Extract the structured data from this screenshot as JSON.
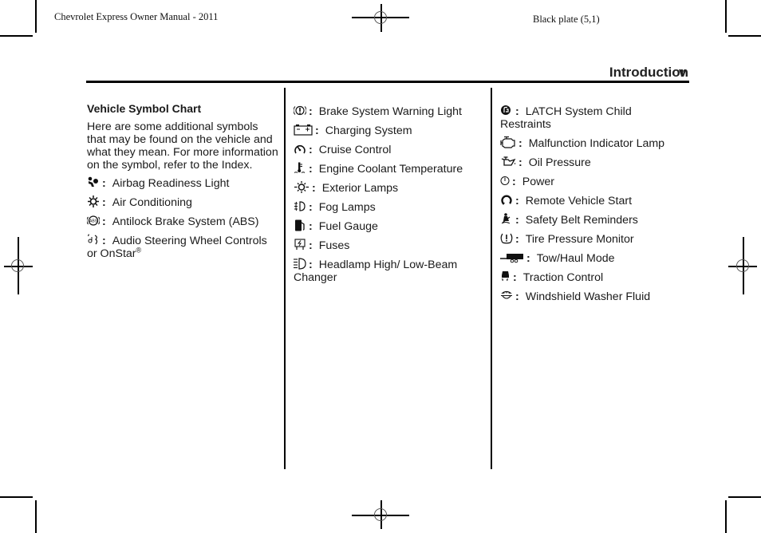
{
  "print_header": {
    "manual_title": "Chevrolet Express Owner Manual - 2011",
    "plate": "Black plate (5,1)"
  },
  "page_header": {
    "section": "Introduction",
    "page_number": "v"
  },
  "column1": {
    "heading": "Vehicle Symbol Chart",
    "intro": "Here are some additional symbols that may be found on the vehicle and what they mean. For more information on the symbol, refer to the Index.",
    "items": [
      {
        "icon": "airbag-icon",
        "label": "Airbag Readiness Light"
      },
      {
        "icon": "air-conditioning-icon",
        "label": "Air Conditioning"
      },
      {
        "icon": "abs-icon",
        "label": "Antilock Brake System (ABS)"
      },
      {
        "icon": "audio-steering-controls-icon",
        "label": "Audio Steering Wheel Controls or OnStar",
        "suffix": "®"
      }
    ]
  },
  "column2": {
    "items": [
      {
        "icon": "brake-warning-icon",
        "label": "Brake System Warning Light"
      },
      {
        "icon": "battery-icon",
        "label": "Charging System"
      },
      {
        "icon": "cruise-control-icon",
        "label": "Cruise Control"
      },
      {
        "icon": "coolant-temperature-icon",
        "label": "Engine Coolant Temperature"
      },
      {
        "icon": "exterior-lamps-icon",
        "label": "Exterior Lamps"
      },
      {
        "icon": "fog-lamps-icon",
        "label": "Fog Lamps"
      },
      {
        "icon": "fuel-gauge-icon",
        "label": "Fuel Gauge"
      },
      {
        "icon": "fuses-icon",
        "label": "Fuses"
      },
      {
        "icon": "headlamp-beam-icon",
        "label": "Headlamp High/ Low-Beam Changer"
      }
    ]
  },
  "column3": {
    "items": [
      {
        "icon": "latch-child-seat-icon",
        "label": "LATCH System Child Restraints"
      },
      {
        "icon": "engine-malfunction-icon",
        "label": "Malfunction Indicator Lamp"
      },
      {
        "icon": "oil-pressure-icon",
        "label": "Oil Pressure"
      },
      {
        "icon": "power-icon",
        "label": "Power"
      },
      {
        "icon": "remote-start-icon",
        "label": "Remote Vehicle Start"
      },
      {
        "icon": "seatbelt-icon",
        "label": "Safety Belt Reminders"
      },
      {
        "icon": "tire-pressure-icon",
        "label": "Tire Pressure Monitor"
      },
      {
        "icon": "tow-haul-icon",
        "label": "Tow/Haul Mode"
      },
      {
        "icon": "traction-control-icon",
        "label": "Traction Control"
      },
      {
        "icon": "washer-fluid-icon",
        "label": "Windshield Washer Fluid"
      }
    ],
    "separator": ":"
  }
}
